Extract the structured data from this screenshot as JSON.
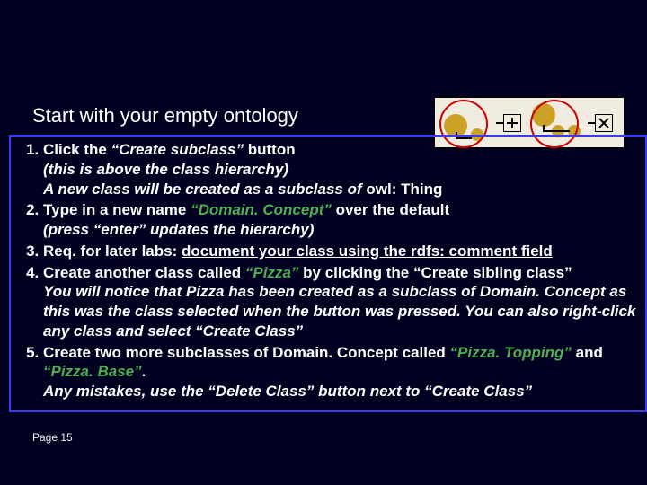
{
  "heading": "Start with your empty ontology",
  "icons": {
    "create_subclass": "create-subclass-icon",
    "create_sibling": "create-sibling-icon",
    "delete_class": "delete-class-icon"
  },
  "steps": [
    {
      "num": "1.",
      "line1_pre": "Click the ",
      "line1_quote": "“Create subclass”",
      "line1_post": " button",
      "sub1": "(this is above the class hierarchy)",
      "sub2_pre": "A new class will be created as a subclass of ",
      "sub2_bold": "owl: Thing"
    },
    {
      "num": "2.",
      "line1_pre": "Type in a new name ",
      "line1_green": "“Domain. Concept”",
      "line1_post": " over the default",
      "sub1": "(press “enter” updates the hierarchy)"
    },
    {
      "num": "3.",
      "line1_pre": "Req. for later labs: ",
      "line1_under": "document your class using the rdfs: comment field"
    },
    {
      "num": "4.",
      "line1_pre": "Create another class called ",
      "line1_green": "“Pizza”",
      "line1_post": " by clicking the “Create sibling class”",
      "sub_block": "You will notice that Pizza has been created as a subclass of Domain. Concept as this was the class selected when the button was pressed. You can also right-click any class and select “Create Class”"
    },
    {
      "num": "5.",
      "line1_pre": "Create two more subclasses of ",
      "line1_bold": "Domain. Concept",
      "line1_mid": " called ",
      "line1_green1": "“Pizza. Topping”",
      "line1_and": " and ",
      "line1_green2": "“Pizza. Base”",
      "line1_post": ".",
      "sub1": "Any mistakes, use the “Delete Class” button next to “Create Class”"
    }
  ],
  "footer": "Page 15"
}
